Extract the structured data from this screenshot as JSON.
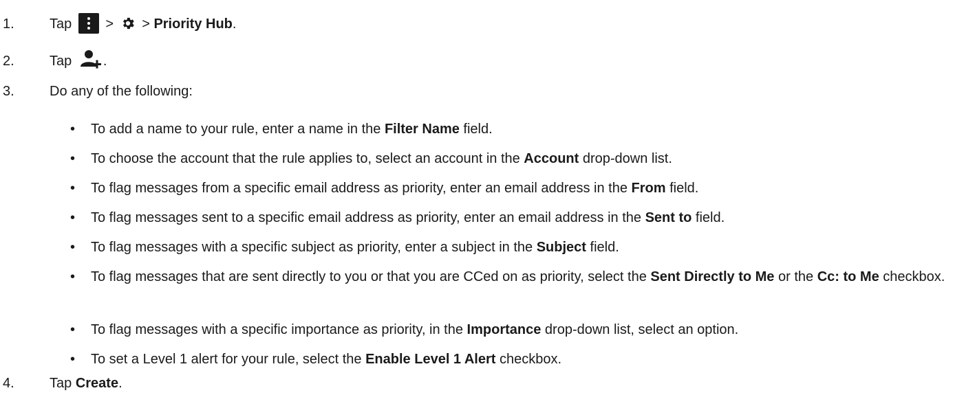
{
  "steps": [
    {
      "num": "1.",
      "word_tap": "Tap",
      "sep1": ">",
      "sep2": ">",
      "target": "Priority Hub",
      "end": ".",
      "icons": [
        "more-menu-icon",
        "gear-icon"
      ]
    },
    {
      "num": "2.",
      "word_tap": "Tap",
      "end": ".",
      "icons": [
        "add-contact-icon"
      ]
    },
    {
      "num": "3.",
      "text": "Do any of the following:"
    },
    {
      "num": "4.",
      "word_tap": "Tap",
      "target": "Create",
      "end": "."
    }
  ],
  "bullets": [
    {
      "pre": "To add a name to your rule, enter a name in the ",
      "bold": "Filter Name",
      "post": " field."
    },
    {
      "pre": "To choose the account that the rule applies to, select an account in the ",
      "bold": "Account",
      "post": " drop-down list."
    },
    {
      "pre": "To flag messages from a specific email address as priority, enter an email address in the ",
      "bold": "From",
      "post": " field."
    },
    {
      "pre": "To flag messages sent to a specific email address as priority, enter an email address in the ",
      "bold": "Sent to",
      "post": " field."
    },
    {
      "pre": "To flag messages with a specific subject as priority, enter a subject in the ",
      "bold": "Subject",
      "post": " field."
    },
    {
      "pre": "To flag messages that are sent directly to you or that you are CCed on as priority, select the ",
      "bold": "Sent Directly to Me",
      "mid": " or the ",
      "bold2": "Cc: to Me",
      "post": " checkbox."
    },
    {
      "pre": "To flag messages with a specific importance as priority, in the ",
      "bold": "Importance",
      "post": " drop-down list, select an option."
    },
    {
      "pre": "To set a Level 1 alert for your rule, select the ",
      "bold": "Enable Level 1 Alert",
      "post": " checkbox."
    }
  ],
  "bullet_char": "•"
}
